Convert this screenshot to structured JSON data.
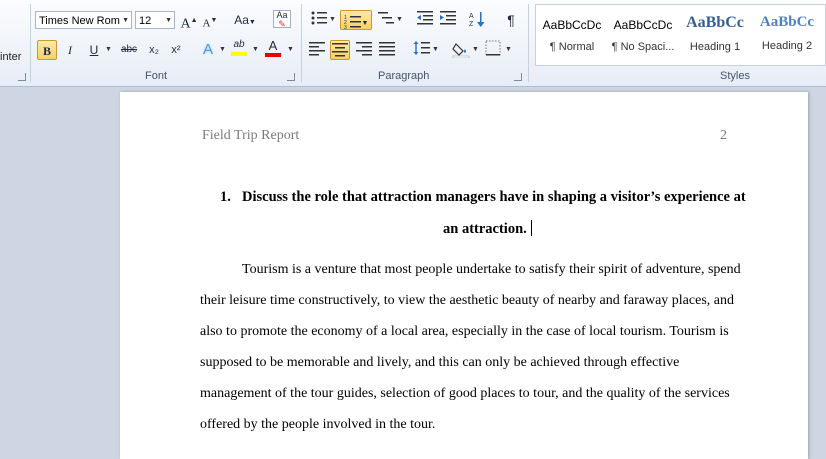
{
  "clipboard": {
    "partial_label": "inter"
  },
  "font": {
    "name": "Times New Rom",
    "size": "12",
    "group_label": "Font",
    "grow_label": "A",
    "shrink_label": "A",
    "case_label": "Aa",
    "bold_label": "B",
    "italic_label": "I",
    "underline_label": "U",
    "strike_label": "abc",
    "subscript_label": "x₂",
    "superscript_label": "x²",
    "effects_label": "A",
    "highlight_label": "ab",
    "color_label": "A"
  },
  "paragraph": {
    "group_label": "Paragraph",
    "show_marks_label": "¶"
  },
  "styles": {
    "group_label": "Styles",
    "items": [
      {
        "sample": "AaBbCcDc",
        "name": "¶ Normal"
      },
      {
        "sample": "AaBbCcDc",
        "name": "¶ No Spaci..."
      },
      {
        "sample": "AaBbCc",
        "name": "Heading 1"
      },
      {
        "sample": "AaBbCc",
        "name": "Heading 2"
      }
    ]
  },
  "colors": {
    "highlight": "#ffff00",
    "font_color": "#e00000",
    "heading1": "#365f91",
    "heading2": "#4f81bd",
    "active_button": "#f8cf6a"
  },
  "document": {
    "header_title": "Field Trip Report",
    "page_number": "2",
    "heading_number": "1.",
    "heading_line1": "Discuss the role that attraction managers have in shaping a visitor’s experience at",
    "heading_line2": "an attraction.",
    "body_lines": [
      "Tourism is a venture that most people undertake to satisfy their spirit of adventure, spend",
      "their leisure time constructively, to view the aesthetic beauty of nearby and faraway places, and",
      "also to promote the economy of a local area, especially in the case of local tourism. Tourism is",
      "supposed to be memorable and lively, and this can only be achieved through effective",
      "management of the tour guides, selection of good places to tour, and the quality of the services",
      "offered by the people involved in the tour."
    ]
  }
}
